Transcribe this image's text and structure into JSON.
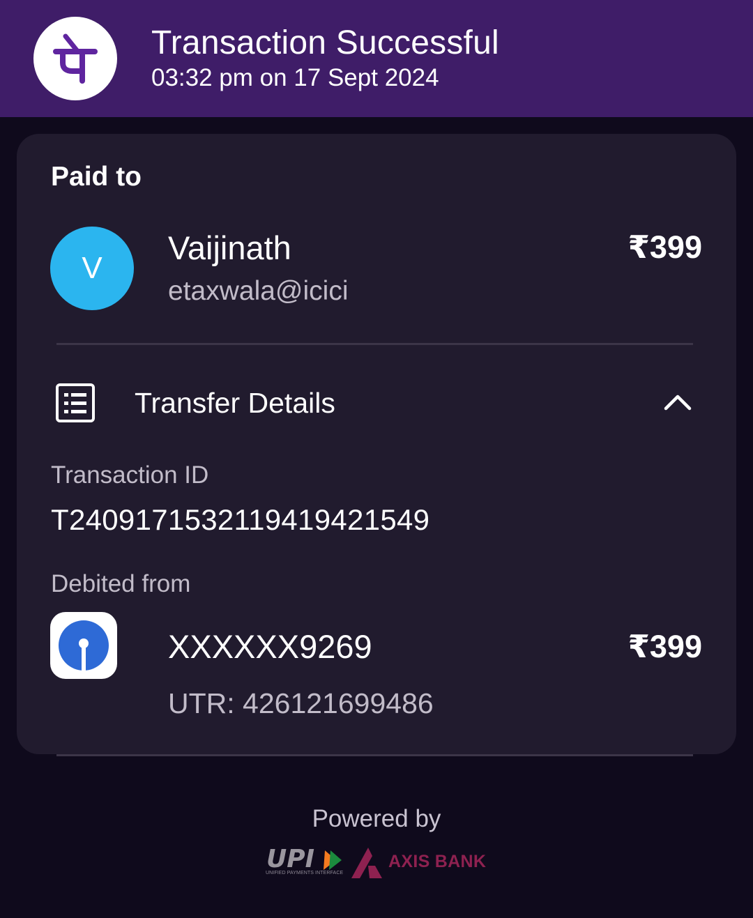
{
  "header": {
    "title": "Transaction Successful",
    "datetime": "03:32 pm on 17 Sept 2024",
    "app_icon": "phonepe-logo-icon",
    "bg_color": "#3f1d68"
  },
  "paid_to": {
    "label": "Paid to",
    "avatar_initial": "V",
    "name": "Vaijinath",
    "upi_id": "etaxwala@icici",
    "amount": "₹399",
    "avatar_color": "#2bb5ef"
  },
  "transfer_details": {
    "title": "Transfer Details",
    "icon": "receipt-list-icon",
    "toggle_icon": "chevron-up-icon",
    "transaction_id_label": "Transaction ID",
    "transaction_id": "T2409171532119419421549",
    "debited_from_label": "Debited from",
    "bank_icon": "sbi-bank-icon",
    "account": "XXXXXX9269",
    "amount": "₹399",
    "utr": "UTR: 426121699486"
  },
  "footer": {
    "powered_by": "Powered by",
    "upi_logo_text": "UPI",
    "upi_tagline": "UNIFIED PAYMENTS INTERFACE",
    "bank_name": "AXIS BANK"
  }
}
